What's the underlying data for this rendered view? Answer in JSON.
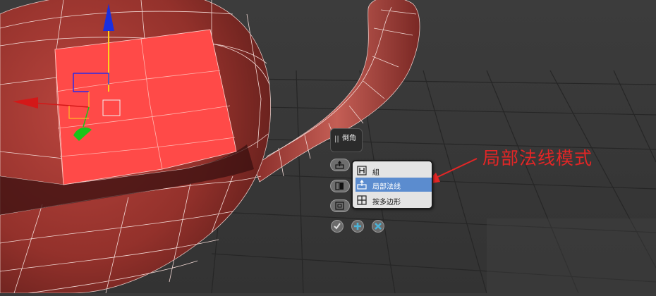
{
  "viewport": {
    "scene": "teapot polygon model with selected faces and transform gizmo",
    "background_color": "#3a3a3a",
    "model_color": "#a33a35",
    "selection_color": "#ff4a48",
    "icons": [
      "move-gizmo-z-arrow-icon",
      "move-gizmo-x-arrow-icon",
      "move-gizmo-y-arrow-icon"
    ]
  },
  "caddy": {
    "title": "倒角",
    "grip_icon": "grip-icon",
    "buttons": [
      {
        "name": "extrude-type-button",
        "icon": "local-normal-icon"
      },
      {
        "name": "height-button",
        "icon": "height-icon"
      },
      {
        "name": "outline-button",
        "icon": "outline-icon"
      }
    ],
    "actions": [
      {
        "name": "ok-button",
        "icon": "check-icon"
      },
      {
        "name": "apply-button",
        "icon": "plus-icon"
      },
      {
        "name": "cancel-button",
        "icon": "x-icon"
      }
    ]
  },
  "dropdown": {
    "items": [
      {
        "label": "組",
        "icon": "group-icon",
        "selected": false
      },
      {
        "label": "局部法线",
        "icon": "local-normal-icon",
        "selected": true
      },
      {
        "label": "按多边形",
        "icon": "by-polygon-icon",
        "selected": false
      }
    ]
  },
  "annotation": {
    "text": "局部法线模式",
    "color": "#e32626"
  }
}
